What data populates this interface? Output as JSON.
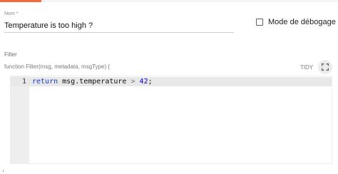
{
  "form": {
    "name_label": "Nom *",
    "name_value": "Temperature is too high ?",
    "debug_label": "Mode de débogage",
    "debug_checked": false
  },
  "filter": {
    "label": "Filter",
    "signature": "function Filter(msg, metadata, msgType) {",
    "tidy_label": "TIDY",
    "fullscreen_icon": "fullscreen-icon"
  },
  "editor": {
    "line_number": "1",
    "tokens": {
      "keyword": "return",
      "expr": " msg.temperature ",
      "operator": ">",
      "number": "42",
      "semicolon": ";"
    }
  },
  "colors": {
    "accent": "#f26b3a",
    "keyword": "#1a3dd1",
    "number": "#0000cd"
  }
}
